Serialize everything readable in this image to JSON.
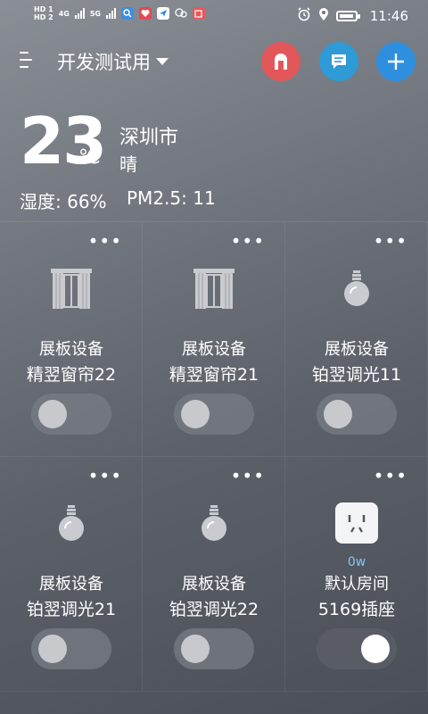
{
  "status_bar": {
    "hd1": "HD 1",
    "hd2": "HD 2",
    "net1": "4G",
    "net2": "5G",
    "time": "11:46"
  },
  "header": {
    "title": "开发测试用"
  },
  "weather": {
    "temperature": "23",
    "unit": "℃",
    "city": "深圳市",
    "condition": "晴",
    "humidity_label": "湿度:",
    "humidity_value": "66%",
    "pm_label": "PM2.5:",
    "pm_value": "11"
  },
  "devices": [
    {
      "room": "展板设备",
      "name": "精翌窗帘22",
      "icon": "curtain-icon",
      "state": "off",
      "power": ""
    },
    {
      "room": "展板设备",
      "name": "精翌窗帘21",
      "icon": "curtain-icon",
      "state": "off",
      "power": ""
    },
    {
      "room": "展板设备",
      "name": "铂翌调光11",
      "icon": "bulb-icon",
      "state": "off",
      "power": ""
    },
    {
      "room": "展板设备",
      "name": "铂翌调光21",
      "icon": "bulb-icon",
      "state": "off",
      "power": ""
    },
    {
      "room": "展板设备",
      "name": "铂翌调光22",
      "icon": "bulb-icon",
      "state": "off",
      "power": ""
    },
    {
      "room": "默认房间",
      "name": "5169插座",
      "icon": "socket-icon",
      "state": "on",
      "power": "0w"
    }
  ],
  "colors": {
    "door_button": "#e2575a",
    "message_button": "#2f9ad6",
    "add_button": "#2f8fdf",
    "power_text": "#7ec9ff"
  }
}
